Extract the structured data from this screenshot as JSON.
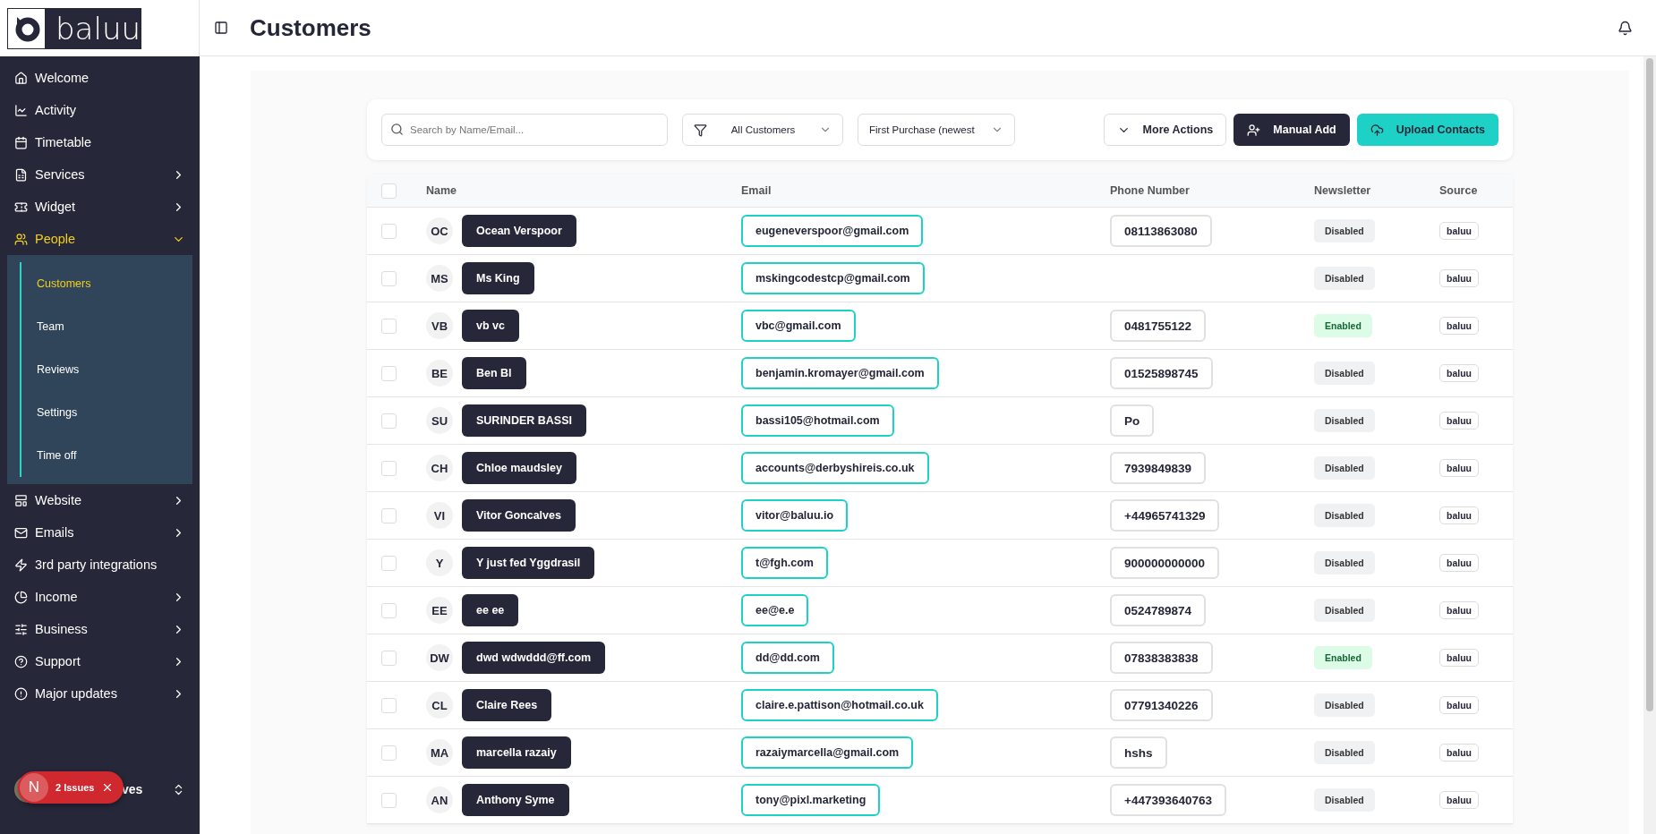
{
  "logo": {
    "text": "baluu"
  },
  "header": {
    "title": "Customers"
  },
  "sidebar": {
    "items": [
      {
        "label": "Welcome",
        "kind": "link",
        "selected": false
      },
      {
        "label": "Activity",
        "kind": "link",
        "selected": false
      },
      {
        "label": "Timetable",
        "kind": "link",
        "selected": false
      },
      {
        "label": "Services",
        "kind": "group",
        "selected": false,
        "expanded": false
      },
      {
        "label": "Widget",
        "kind": "group",
        "selected": false,
        "expanded": false
      },
      {
        "label": "People",
        "kind": "group",
        "selected": true,
        "expanded": true,
        "children": [
          {
            "label": "Customers",
            "selected": true
          },
          {
            "label": "Team",
            "selected": false
          },
          {
            "label": "Reviews",
            "selected": false
          },
          {
            "label": "Settings",
            "selected": false
          },
          {
            "label": "Time off",
            "selected": false
          }
        ]
      },
      {
        "label": "Website",
        "kind": "group",
        "selected": false,
        "expanded": false
      },
      {
        "label": "Emails",
        "kind": "group",
        "selected": false,
        "expanded": false
      },
      {
        "label": "3rd party integrations",
        "kind": "link",
        "selected": false
      },
      {
        "label": "Income",
        "kind": "group",
        "selected": false,
        "expanded": false
      },
      {
        "label": "Business",
        "kind": "group",
        "selected": false,
        "expanded": false
      },
      {
        "label": "Support",
        "kind": "group",
        "selected": false,
        "expanded": false
      },
      {
        "label": "Major updates",
        "kind": "group",
        "selected": false,
        "expanded": false
      }
    ],
    "user": {
      "name": "ves"
    }
  },
  "issues_toast": {
    "letter": "N",
    "label": "2 Issues"
  },
  "toolbar": {
    "search": {
      "placeholder": "Search by Name/Email..."
    },
    "filter": "All Customers",
    "sort": "First Purchase (newest",
    "buttons": [
      {
        "label": "More Actions",
        "kind": "dropdown"
      },
      {
        "label": "Manual Add",
        "kind": "dark"
      },
      {
        "label": "Upload Contacts",
        "kind": "accent"
      }
    ]
  },
  "table": {
    "select_all_checked": false,
    "columns": [
      "Name",
      "Email",
      "Phone Number",
      "Newsletter",
      "Source"
    ],
    "rows": [
      {
        "checked": false,
        "initials": "OC",
        "name": "Ocean Verspoor",
        "email": "eugeneverspoor@gmail.com",
        "phone": "08113863080",
        "newsletter": {
          "label": "Disabled",
          "on": false
        },
        "source": "baluu"
      },
      {
        "checked": false,
        "initials": "MS",
        "name": "Ms King",
        "email": "mskingcodestcp@gmail.com",
        "newsletter": {
          "label": "Disabled",
          "on": false
        },
        "source": "baluu"
      },
      {
        "checked": false,
        "initials": "VB",
        "name": "vb vc",
        "email": "vbc@gmail.com",
        "phone": "0481755122",
        "newsletter": {
          "label": "Enabled",
          "on": true
        },
        "source": "baluu"
      },
      {
        "checked": false,
        "initials": "BE",
        "name": "Ben Bl",
        "email": "benjamin.kromayer@gmail.com",
        "phone": "01525898745",
        "newsletter": {
          "label": "Disabled",
          "on": false
        },
        "source": "baluu"
      },
      {
        "checked": false,
        "initials": "SU",
        "name": "SURINDER BASSI",
        "email": "bassi105@hotmail.com",
        "phone": "Po",
        "newsletter": {
          "label": "Disabled",
          "on": false
        },
        "source": "baluu"
      },
      {
        "checked": false,
        "initials": "CH",
        "name": "Chloe maudsley",
        "email": "accounts@derbyshireis.co.uk",
        "phone": "7939849839",
        "newsletter": {
          "label": "Disabled",
          "on": false
        },
        "source": "baluu"
      },
      {
        "checked": false,
        "initials": "VI",
        "name": "Vitor Goncalves",
        "email": "vitor@baluu.io",
        "phone": "+44965741329",
        "newsletter": {
          "label": "Disabled",
          "on": false
        },
        "source": "baluu"
      },
      {
        "checked": false,
        "initials": "Y",
        "name": "Y just fed Yggdrasil",
        "email": "t@fgh.com",
        "phone": "900000000000",
        "newsletter": {
          "label": "Disabled",
          "on": false
        },
        "source": "baluu"
      },
      {
        "checked": false,
        "initials": "EE",
        "name": "ee ee",
        "email": "ee@e.e",
        "phone": "0524789874",
        "newsletter": {
          "label": "Disabled",
          "on": false
        },
        "source": "baluu"
      },
      {
        "checked": false,
        "initials": "DW",
        "name": "dwd wdwddd@ff.com",
        "email": "dd@dd.com",
        "phone": "07838383838",
        "newsletter": {
          "label": "Enabled",
          "on": true
        },
        "source": "baluu"
      },
      {
        "checked": false,
        "initials": "CL",
        "name": "Claire Rees",
        "email": "claire.e.pattison@hotmail.co.uk",
        "phone": "07791340226",
        "newsletter": {
          "label": "Disabled",
          "on": false
        },
        "source": "baluu"
      },
      {
        "checked": false,
        "initials": "MA",
        "name": "marcella razaiy",
        "email": "razaiymarcella@gmail.com",
        "phone": "hshs",
        "newsletter": {
          "label": "Disabled",
          "on": false
        },
        "source": "baluu"
      },
      {
        "checked": false,
        "initials": "AN",
        "name": "Anthony Syme",
        "email": "tony@pixl.marketing",
        "phone": "+447393640763",
        "newsletter": {
          "label": "Disabled",
          "on": false
        },
        "source": "baluu"
      }
    ]
  }
}
